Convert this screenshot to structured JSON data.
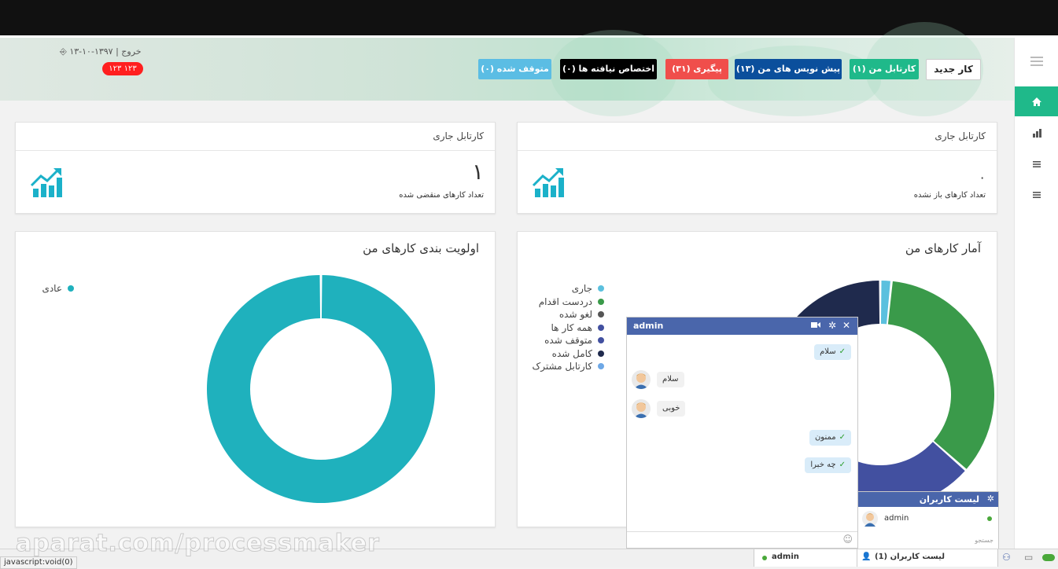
{
  "header": {
    "user_line_date": "۱۳۹۷-۱۰-۱۳",
    "user_line_logout": "خروج",
    "user_badge": "۱۲۳ ۱۲۳",
    "buttons": {
      "new_task": "کار جدید",
      "my_inbox": "کارتابل من (۱)",
      "drafts": "پیش نویس های من (۱۳)",
      "follow_up": "پیگیری (۳۱)",
      "unassigned": "اختصاص نیافته ها (۰)",
      "paused": "متوقف شده (۰)"
    },
    "colors": {
      "my_inbox": "#1fb98a",
      "drafts": "#0b4f9c",
      "follow_up": "#f04e4b",
      "unassigned": "#000000",
      "paused": "#5bbde4"
    }
  },
  "sidebar": {
    "items": [
      {
        "icon": "menu-icon"
      },
      {
        "icon": "home-icon",
        "active": true
      },
      {
        "icon": "bar-chart-icon"
      },
      {
        "icon": "list-icon"
      },
      {
        "icon": "list-icon"
      }
    ]
  },
  "cards": {
    "right_stat": {
      "title": "کارتابل جاری",
      "value": "۰",
      "label": "تعداد کارهای باز نشده"
    },
    "left_stat": {
      "title": "کارتابل جاری",
      "value": "۱",
      "label": "تعداد کارهای منقضی شده"
    },
    "stats_chart": {
      "title": "آمار کارهای من"
    },
    "priority_chart": {
      "title": "اولویت بندی کارهای من"
    }
  },
  "chart_data": [
    {
      "type": "pie",
      "title": "آمار کارهای من",
      "donut": true,
      "legend": "left",
      "series": [
        {
          "name": "جاری",
          "value": 1,
          "color": "#5bc0de"
        },
        {
          "name": "دردست اقدام",
          "value": 22,
          "color": "#3a9a4a"
        },
        {
          "name": "لغو شده",
          "value": 0,
          "color": "#555555"
        },
        {
          "name": "همه کار ها",
          "value": 0,
          "color": "#4250a0"
        },
        {
          "name": "متوقف شده",
          "value": 22,
          "color": "#4250a0"
        },
        {
          "name": "کامل شده",
          "value": 18,
          "color": "#1f2a4d"
        },
        {
          "name": "کارتابل مشترک",
          "value": 0,
          "color": "#6ea8e6"
        }
      ]
    },
    {
      "type": "pie",
      "title": "اولویت بندی کارهای من",
      "donut": true,
      "legend": "top-left",
      "series": [
        {
          "name": "عادی",
          "value": 100,
          "color": "#1fb1bd"
        }
      ]
    }
  ],
  "chat": {
    "user": "admin",
    "messages": [
      {
        "dir": "out",
        "text": "سلام"
      },
      {
        "dir": "in",
        "text": "سلام"
      },
      {
        "dir": "in",
        "text": "خوبی"
      },
      {
        "dir": "out",
        "text": "ممنون"
      },
      {
        "dir": "out",
        "text": "چه خبرا"
      }
    ]
  },
  "user_list": {
    "title": "لیست کاربران",
    "users": [
      "admin"
    ],
    "search_placeholder": "جستجو",
    "footer_label": "لیست کاربران (1)",
    "footer_user": "admin"
  },
  "status_url": "javascript:void(0)",
  "watermark": "aparat.com/processmaker"
}
